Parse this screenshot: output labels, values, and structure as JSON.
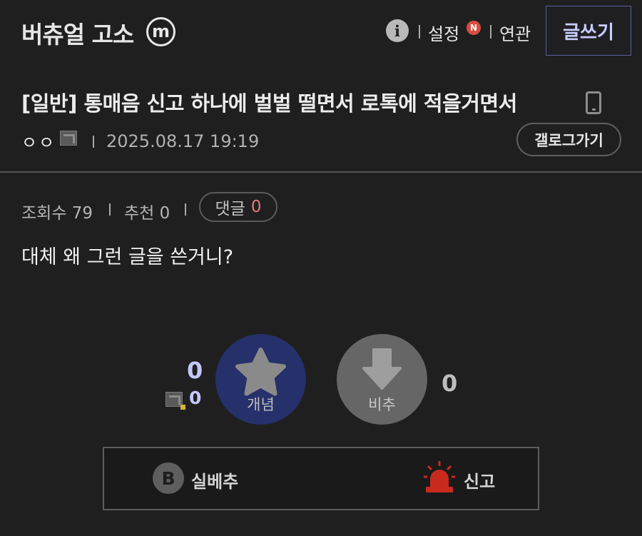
{
  "header": {
    "gallery_name": "버츄얼 고소",
    "minor_badge": "m",
    "info_icon": "i",
    "settings_label": "설정",
    "new_badge": "N",
    "related_label": "연관",
    "write_button": "글쓰기"
  },
  "post": {
    "title": "[일반] 통매음 신고 하나에 벌벌 떨면서 로톡에 적을거면서",
    "author": "ㅇㅇ",
    "datetime": "2025.08.17 19:19",
    "back_to_gallery": "갤로그가기",
    "views_label": "조회수 79",
    "recommend_label": "추천 0",
    "comments_label": "댓글",
    "comments_count": "0",
    "body": "대체 왜 그런 글을 쓴거니?"
  },
  "votes": {
    "up_label": "개념",
    "up_count": "0",
    "up_fixed_count": "0",
    "down_label": "비추",
    "down_count": "0"
  },
  "actions": {
    "b_icon": "B",
    "real_best_label": "실베추",
    "report_label": "신고"
  },
  "colors": {
    "background": "#1f1f20",
    "accent": "#c9cdfc",
    "up_circle": "#26306a",
    "down_circle": "#666666",
    "report_red": "#c92a1e",
    "comment_count": "#e07d75"
  }
}
